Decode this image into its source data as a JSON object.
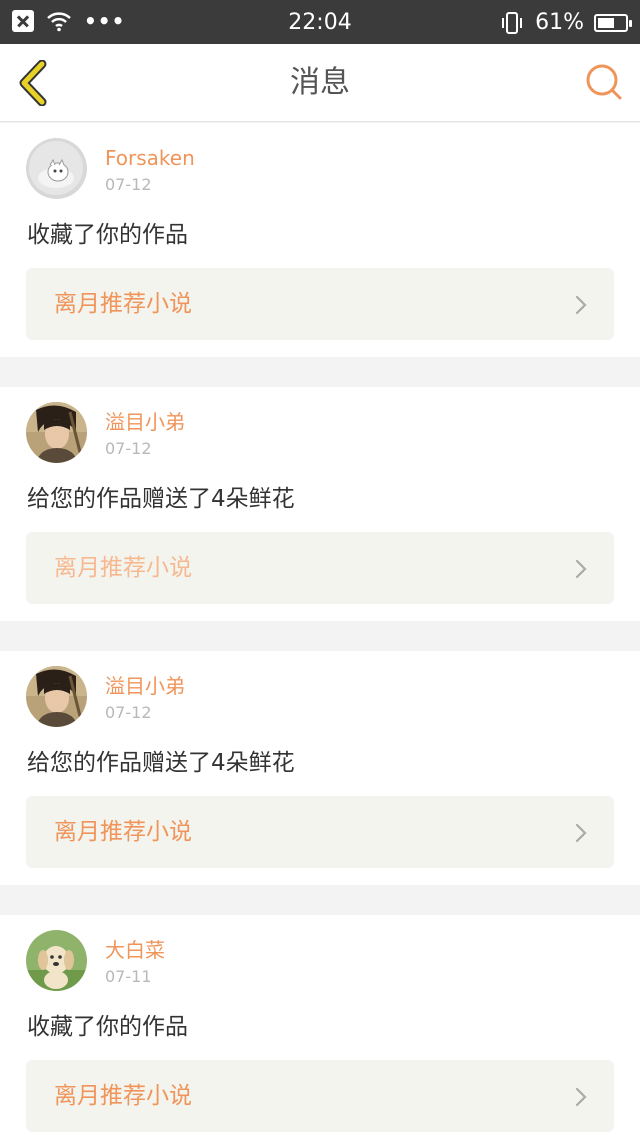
{
  "status_bar": {
    "time": "22:04",
    "battery_percent": "61%",
    "battery_level": 0.61,
    "icons": [
      "close-notification-icon",
      "wifi-icon",
      "more-dots-icon",
      "vibrate-phone-icon",
      "battery-icon"
    ],
    "dots": "•••"
  },
  "nav": {
    "title": "消息",
    "back_icon": "chevron-left-icon",
    "search_icon": "search-icon",
    "accent": "#f0955a",
    "back_color": "#e8d227"
  },
  "messages": [
    {
      "username": "Forsaken",
      "date": "07-12",
      "text": "收藏了你的作品",
      "link": "离月推荐小说",
      "avatar": "cat-avatar"
    },
    {
      "username": "溢目小弟",
      "date": "07-12",
      "text": "给您的作品赠送了4朵鲜花",
      "link": "离月推荐小说",
      "avatar": "warrior-avatar"
    },
    {
      "username": "溢目小弟",
      "date": "07-12",
      "text": "给您的作品赠送了4朵鲜花",
      "link": "离月推荐小说",
      "avatar": "warrior-avatar"
    },
    {
      "username": "大白菜",
      "date": "07-11",
      "text": "收藏了你的作品",
      "link": "离月推荐小说",
      "avatar": "puppy-avatar"
    }
  ]
}
